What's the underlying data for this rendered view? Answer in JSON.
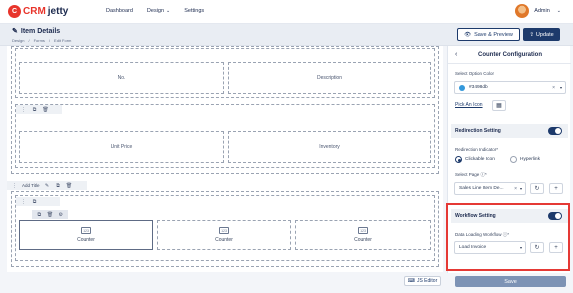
{
  "app": {
    "logo_crm": "CRM",
    "logo_jetty": "jetty",
    "logo_mark": "C"
  },
  "nav": {
    "dashboard": "Dashboard",
    "design": "Design",
    "settings": "Settings"
  },
  "user": {
    "name": "Admin"
  },
  "header": {
    "title": "Item Details",
    "breadcrumbs": [
      "Design",
      "Forms",
      "Edit Form"
    ],
    "save_preview": "Save & Preview",
    "update": "Update"
  },
  "canvas": {
    "row1": [
      "No.",
      "Description"
    ],
    "row2": [
      "Unit Price",
      "Inventory"
    ],
    "section_toolbar_label": "Add Title",
    "counters": [
      "Counter",
      "Counter",
      "Counter"
    ],
    "js_editor": "JS Editor"
  },
  "panel": {
    "title": "Counter Configuration",
    "select_option_color_label": "Select Option Color",
    "color_value": "#3498db",
    "pick_icon": "Pick An Icon",
    "redirection_setting": "Redirection Setting",
    "redirection_indicator_label": "Redirection Indicator*",
    "radio_clickable": "Clickable Icon",
    "radio_hyperlink": "Hyperlink",
    "select_page_label": "Select Page ⓘ*",
    "select_page_value": "Sales Line Item De...",
    "workflow_setting": "Workflow Setting",
    "data_loading_workflow_label": "Data Loading Workflow ⓘ*",
    "data_loading_workflow_value": "Load Invoice",
    "save": "Save"
  },
  "colors": {
    "brand_red": "#e8342b",
    "primary_navy": "#1d3a6b",
    "highlight_red": "#e53935",
    "option_color": "#3498db"
  }
}
